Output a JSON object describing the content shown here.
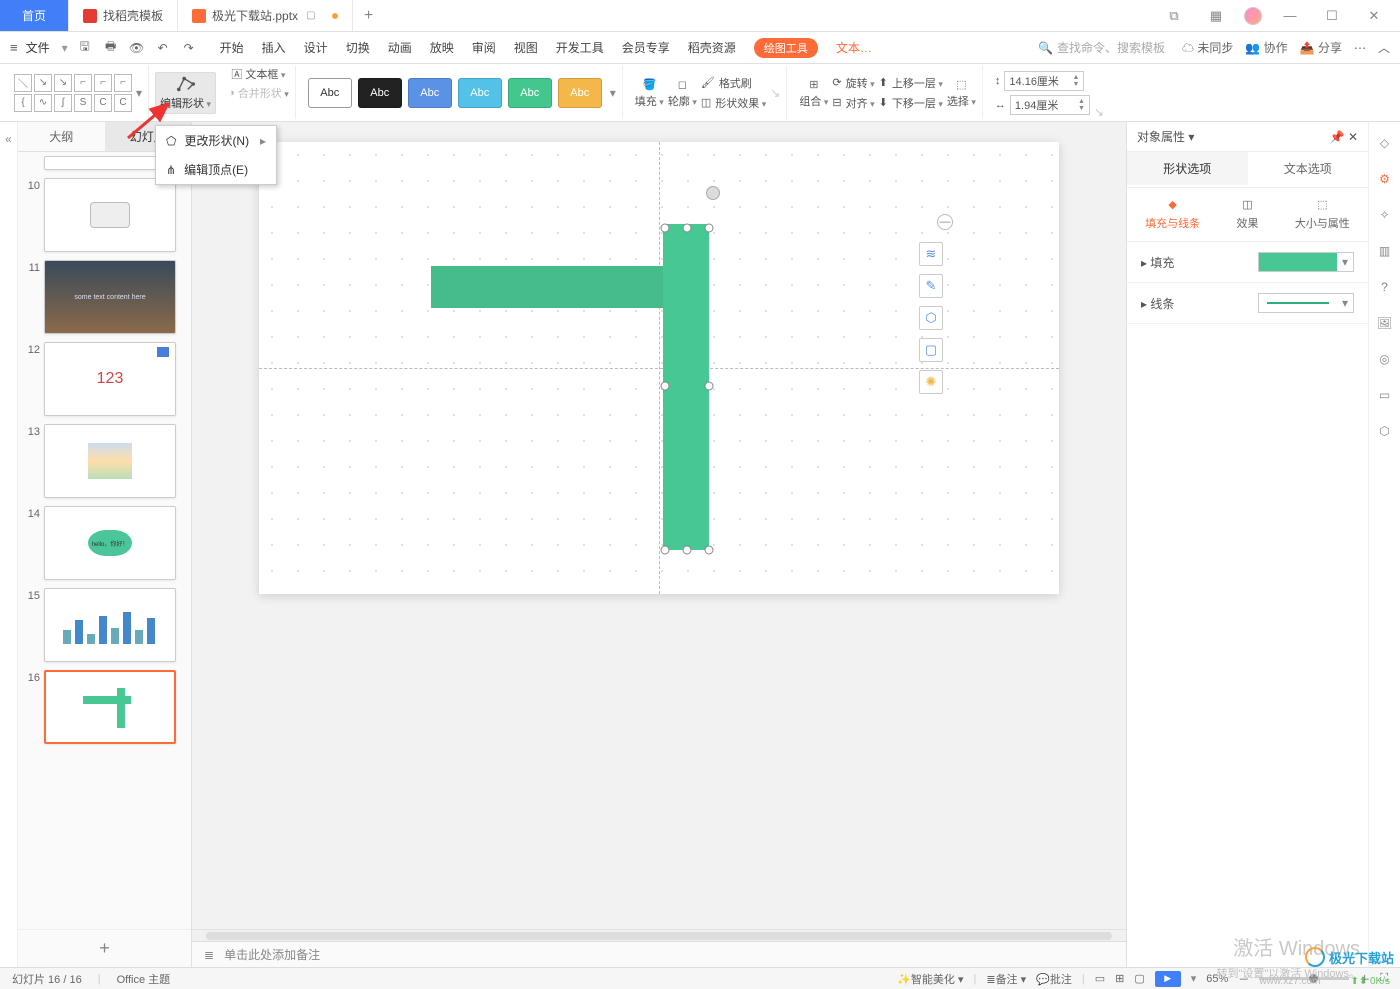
{
  "titlebar": {
    "home": "首页",
    "template_tab": "找稻壳模板",
    "doc_tab": "极光下载站.pptx",
    "add": "+"
  },
  "menubar": {
    "file": "文件",
    "tabs": [
      "开始",
      "插入",
      "设计",
      "切换",
      "动画",
      "放映",
      "审阅",
      "视图",
      "开发工具",
      "会员专享",
      "稻壳资源"
    ],
    "drawtool": "绘图工具",
    "texttool": "文本…",
    "search_ph": "查找命令、搜索模板",
    "unsync": "未同步",
    "coop": "协作",
    "share": "分享"
  },
  "ribbon": {
    "edit_shape": "编辑形状",
    "textbox": "文本框",
    "merge": "合并形状",
    "style_label": "Abc",
    "fill": "填充",
    "outline": "轮廓",
    "effect": "形状效果",
    "format_painter": "格式刷",
    "group": "组合",
    "rotate": "旋转",
    "align": "对齐",
    "up": "上移一层",
    "down": "下移一层",
    "select": "选择",
    "height": "14.16厘米",
    "width": "1.94厘米"
  },
  "dropdown": {
    "change": "更改形状(N)",
    "edit_pts": "编辑顶点(E)"
  },
  "leftpanel": {
    "outline": "大纲",
    "slides": "幻灯片",
    "nums": [
      "10",
      "11",
      "12",
      "13",
      "14",
      "15",
      "16"
    ],
    "t12": "123",
    "t14": "hello，你好！"
  },
  "canvas": {
    "notes_hint": "单击此处添加备注"
  },
  "rightpanel": {
    "title": "对象属性",
    "shape_opt": "形状选项",
    "text_opt": "文本选项",
    "sub_fill": "填充与线条",
    "sub_effect": "效果",
    "sub_size": "大小与属性",
    "fill": "填充",
    "line": "线条"
  },
  "status": {
    "slide": "幻灯片 16 / 16",
    "theme": "Office 主题",
    "beautify": "智能美化",
    "notes": "备注",
    "comment": "批注",
    "zoom": "65%"
  },
  "watermark": {
    "l1": "激活 Windows",
    "l2": "转到\"设置\"以激活 Windows。"
  },
  "brand": "极光下载站",
  "brand_url": "www.xz7.com",
  "net": "0K/s"
}
